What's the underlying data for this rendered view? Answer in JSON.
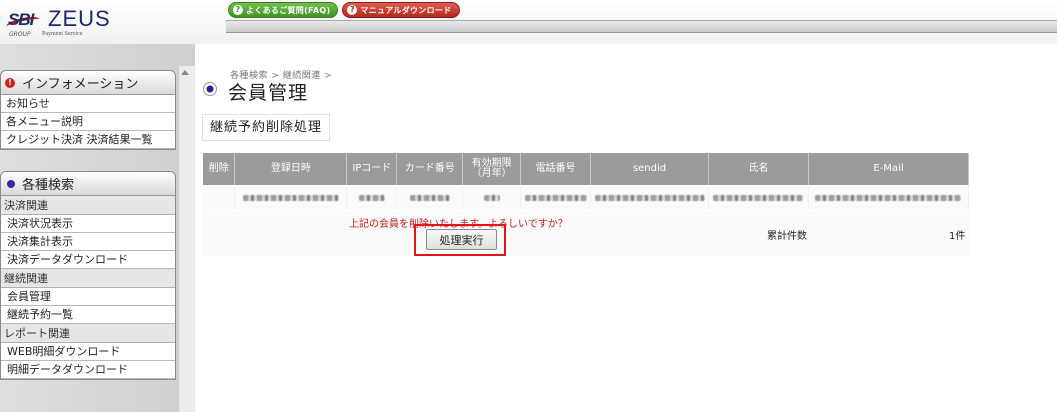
{
  "header": {
    "logo_sbi": "SBI",
    "logo_zeus": "ZEUS",
    "logo_group": "GROUP",
    "logo_service": "Payment Service",
    "faq_button": "よくあるご質問(FAQ)",
    "manual_button": "マニュアルダウンロード",
    "button_icon_glyph": "?"
  },
  "sidebar": {
    "info_panel": {
      "title": "インフォメーション",
      "icon_glyph": "!",
      "items": [
        "お知らせ",
        "各メニュー説明",
        "クレジット決済 決済結果一覧"
      ]
    },
    "search_panel": {
      "title": "各種検索",
      "categories": [
        {
          "label": "決済関連",
          "items": [
            "決済状況表示",
            "決済集計表示",
            "決済データダウンロード"
          ]
        },
        {
          "label": "継続関連",
          "items": [
            "会員管理",
            "継続予約一覧"
          ]
        },
        {
          "label": "レポート関連",
          "items": [
            "WEB明細ダウンロード",
            "明細データダウンロード"
          ]
        }
      ]
    }
  },
  "main": {
    "breadcrumb": "各種検索 > 継続関連 >",
    "page_title": "会員管理",
    "section_title": "継続予約削除処理",
    "table": {
      "headers": [
        "削除",
        "登録日時",
        "IPコード",
        "カード番号",
        "有効期限",
        "（月年）",
        "電話番号",
        "sendid",
        "氏名",
        "E-Mail"
      ]
    },
    "confirm_message": "上記の会員を削除いたします。よろしいですか？",
    "execute_button": "処理実行",
    "count_label": "累計件数",
    "count_value": "1件"
  }
}
